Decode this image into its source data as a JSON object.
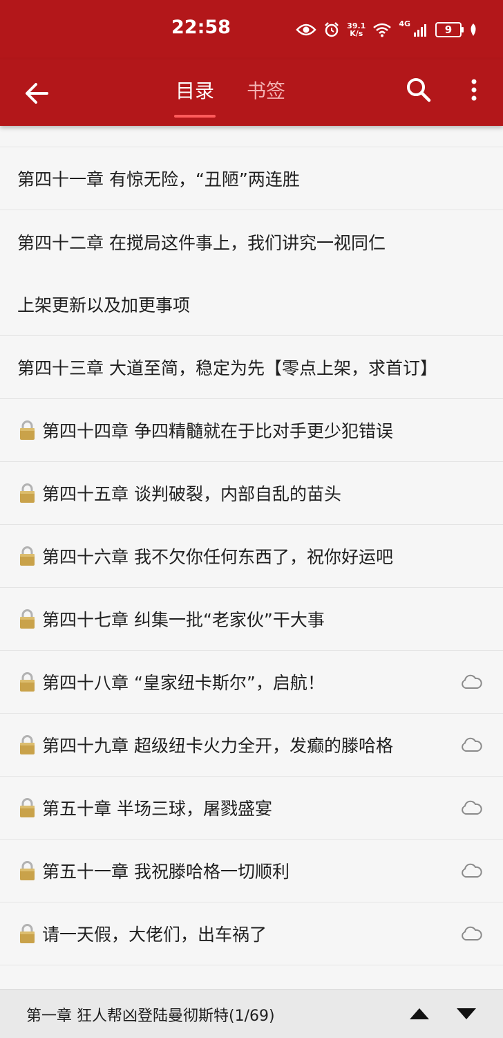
{
  "status_bar": {
    "time": "22:58",
    "net_speed_value": "39.1",
    "net_speed_unit": "K/s",
    "network_type": "4G",
    "battery": "9"
  },
  "app_bar": {
    "tabs": [
      {
        "label": "目录",
        "active": true
      },
      {
        "label": "书签",
        "active": false
      }
    ],
    "icons": [
      "back-arrow-icon",
      "search-icon",
      "more-vert-icon"
    ]
  },
  "chapters": [
    {
      "title": "第四十一章 有惊无险，“丑陋”两连胜",
      "locked": false,
      "cloud": false
    },
    {
      "title": "第四十二章 在搅局这件事上，我们讲究一视同仁",
      "locked": false,
      "cloud": false
    },
    {
      "title": "上架更新以及加更事项",
      "locked": false,
      "cloud": false
    },
    {
      "title": "第四十三章 大道至简，稳定为先【零点上架，求首订】",
      "locked": false,
      "cloud": false
    },
    {
      "title": "第四十四章 争四精髓就在于比对手更少犯错误",
      "locked": true,
      "cloud": false
    },
    {
      "title": "第四十五章 谈判破裂，内部自乱的苗头",
      "locked": true,
      "cloud": false
    },
    {
      "title": "第四十六章 我不欠你任何东西了，祝你好运吧",
      "locked": true,
      "cloud": false
    },
    {
      "title": "第四十七章 纠集一批“老家伙”干大事",
      "locked": true,
      "cloud": false
    },
    {
      "title": "第四十八章 “皇家纽卡斯尔”，启航！",
      "locked": true,
      "cloud": true
    },
    {
      "title": "第四十九章 超级纽卡火力全开，发癫的滕哈格",
      "locked": true,
      "cloud": true
    },
    {
      "title": "第五十章 半场三球，屠戮盛宴",
      "locked": true,
      "cloud": true
    },
    {
      "title": "第五十一章 我祝滕哈格一切顺利",
      "locked": true,
      "cloud": true
    },
    {
      "title": "请一天假，大佬们，出车祸了",
      "locked": true,
      "cloud": true
    }
  ],
  "bottom_bar": {
    "current_chapter": "第一章 狂人帮凶登陆曼彻斯特(1/69)"
  },
  "colors": {
    "accent": "#b3171a",
    "tab_indicator": "#ff5b5b",
    "lock_gold": "#c9a24a"
  }
}
